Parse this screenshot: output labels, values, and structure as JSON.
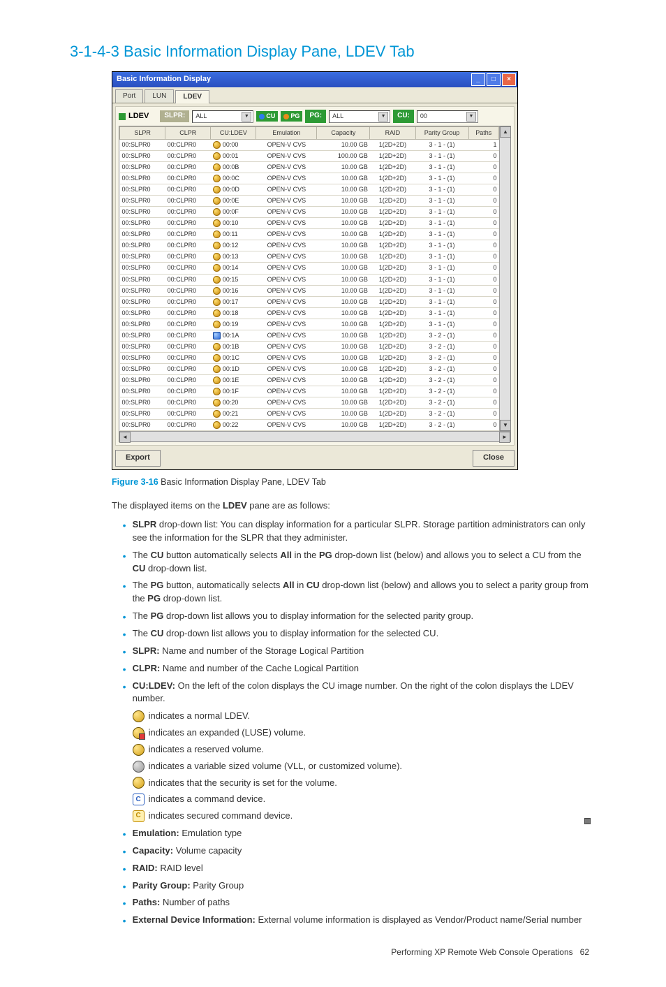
{
  "heading": "3-1-4-3 Basic Information Display Pane, LDEV Tab",
  "figure": {
    "num": "Figure 3-16",
    "caption": "Basic Information Display Pane, LDEV Tab"
  },
  "intro": "The displayed items on the LDEV pane are as follows:",
  "footer": {
    "text": "Performing XP Remote Web Console Operations",
    "page": "62"
  },
  "window": {
    "title": "Basic Information Display",
    "tabs": [
      "Port",
      "LUN",
      "LDEV"
    ],
    "activeTab": "LDEV",
    "toolbar": {
      "ldev_label": "LDEV",
      "slpr_label": "SLPR:",
      "slpr_value": "ALL",
      "cu_btn": "CU",
      "pg_btn": "PG",
      "pg_label": "PG:",
      "pg_value": "ALL",
      "cu_label": "CU:",
      "cu_value": "00"
    },
    "columns": [
      "SLPR",
      "CLPR",
      "CU:LDEV",
      "Emulation",
      "Capacity",
      "RAID",
      "Parity Group",
      "Paths"
    ],
    "rows": [
      {
        "slpr": "00:SLPR0",
        "clpr": "00:CLPR0",
        "icon": "disk",
        "culdev": "00:00",
        "emu": "OPEN-V CVS",
        "cap": "10.00 GB",
        "raid": "1(2D+2D)",
        "pg": "3 - 1 - (1)",
        "paths": "1"
      },
      {
        "slpr": "00:SLPR0",
        "clpr": "00:CLPR0",
        "icon": "disk",
        "culdev": "00:01",
        "emu": "OPEN-V CVS",
        "cap": "100.00 GB",
        "raid": "1(2D+2D)",
        "pg": "3 - 1 - (1)",
        "paths": "0"
      },
      {
        "slpr": "00:SLPR0",
        "clpr": "00:CLPR0",
        "icon": "disk",
        "culdev": "00:0B",
        "emu": "OPEN-V CVS",
        "cap": "10.00 GB",
        "raid": "1(2D+2D)",
        "pg": "3 - 1 - (1)",
        "paths": "0"
      },
      {
        "slpr": "00:SLPR0",
        "clpr": "00:CLPR0",
        "icon": "disk",
        "culdev": "00:0C",
        "emu": "OPEN-V CVS",
        "cap": "10.00 GB",
        "raid": "1(2D+2D)",
        "pg": "3 - 1 - (1)",
        "paths": "0"
      },
      {
        "slpr": "00:SLPR0",
        "clpr": "00:CLPR0",
        "icon": "disk",
        "culdev": "00:0D",
        "emu": "OPEN-V CVS",
        "cap": "10.00 GB",
        "raid": "1(2D+2D)",
        "pg": "3 - 1 - (1)",
        "paths": "0"
      },
      {
        "slpr": "00:SLPR0",
        "clpr": "00:CLPR0",
        "icon": "disk",
        "culdev": "00:0E",
        "emu": "OPEN-V CVS",
        "cap": "10.00 GB",
        "raid": "1(2D+2D)",
        "pg": "3 - 1 - (1)",
        "paths": "0"
      },
      {
        "slpr": "00:SLPR0",
        "clpr": "00:CLPR0",
        "icon": "disk",
        "culdev": "00:0F",
        "emu": "OPEN-V CVS",
        "cap": "10.00 GB",
        "raid": "1(2D+2D)",
        "pg": "3 - 1 - (1)",
        "paths": "0"
      },
      {
        "slpr": "00:SLPR0",
        "clpr": "00:CLPR0",
        "icon": "disk",
        "culdev": "00:10",
        "emu": "OPEN-V CVS",
        "cap": "10.00 GB",
        "raid": "1(2D+2D)",
        "pg": "3 - 1 - (1)",
        "paths": "0"
      },
      {
        "slpr": "00:SLPR0",
        "clpr": "00:CLPR0",
        "icon": "disk",
        "culdev": "00:11",
        "emu": "OPEN-V CVS",
        "cap": "10.00 GB",
        "raid": "1(2D+2D)",
        "pg": "3 - 1 - (1)",
        "paths": "0"
      },
      {
        "slpr": "00:SLPR0",
        "clpr": "00:CLPR0",
        "icon": "disk",
        "culdev": "00:12",
        "emu": "OPEN-V CVS",
        "cap": "10.00 GB",
        "raid": "1(2D+2D)",
        "pg": "3 - 1 - (1)",
        "paths": "0"
      },
      {
        "slpr": "00:SLPR0",
        "clpr": "00:CLPR0",
        "icon": "disk",
        "culdev": "00:13",
        "emu": "OPEN-V CVS",
        "cap": "10.00 GB",
        "raid": "1(2D+2D)",
        "pg": "3 - 1 - (1)",
        "paths": "0"
      },
      {
        "slpr": "00:SLPR0",
        "clpr": "00:CLPR0",
        "icon": "disk",
        "culdev": "00:14",
        "emu": "OPEN-V CVS",
        "cap": "10.00 GB",
        "raid": "1(2D+2D)",
        "pg": "3 - 1 - (1)",
        "paths": "0"
      },
      {
        "slpr": "00:SLPR0",
        "clpr": "00:CLPR0",
        "icon": "disk",
        "culdev": "00:15",
        "emu": "OPEN-V CVS",
        "cap": "10.00 GB",
        "raid": "1(2D+2D)",
        "pg": "3 - 1 - (1)",
        "paths": "0"
      },
      {
        "slpr": "00:SLPR0",
        "clpr": "00:CLPR0",
        "icon": "disk",
        "culdev": "00:16",
        "emu": "OPEN-V CVS",
        "cap": "10.00 GB",
        "raid": "1(2D+2D)",
        "pg": "3 - 1 - (1)",
        "paths": "0"
      },
      {
        "slpr": "00:SLPR0",
        "clpr": "00:CLPR0",
        "icon": "disk",
        "culdev": "00:17",
        "emu": "OPEN-V CVS",
        "cap": "10.00 GB",
        "raid": "1(2D+2D)",
        "pg": "3 - 1 - (1)",
        "paths": "0"
      },
      {
        "slpr": "00:SLPR0",
        "clpr": "00:CLPR0",
        "icon": "disk",
        "culdev": "00:18",
        "emu": "OPEN-V CVS",
        "cap": "10.00 GB",
        "raid": "1(2D+2D)",
        "pg": "3 - 1 - (1)",
        "paths": "0"
      },
      {
        "slpr": "00:SLPR0",
        "clpr": "00:CLPR0",
        "icon": "disk",
        "culdev": "00:19",
        "emu": "OPEN-V CVS",
        "cap": "10.00 GB",
        "raid": "1(2D+2D)",
        "pg": "3 - 1 - (1)",
        "paths": "0"
      },
      {
        "slpr": "00:SLPR0",
        "clpr": "00:CLPR0",
        "icon": "cmd",
        "culdev": "00:1A",
        "emu": "OPEN-V CVS",
        "cap": "10.00 GB",
        "raid": "1(2D+2D)",
        "pg": "3 - 2 - (1)",
        "paths": "0"
      },
      {
        "slpr": "00:SLPR0",
        "clpr": "00:CLPR0",
        "icon": "disk",
        "culdev": "00:1B",
        "emu": "OPEN-V CVS",
        "cap": "10.00 GB",
        "raid": "1(2D+2D)",
        "pg": "3 - 2 - (1)",
        "paths": "0"
      },
      {
        "slpr": "00:SLPR0",
        "clpr": "00:CLPR0",
        "icon": "disk",
        "culdev": "00:1C",
        "emu": "OPEN-V CVS",
        "cap": "10.00 GB",
        "raid": "1(2D+2D)",
        "pg": "3 - 2 - (1)",
        "paths": "0"
      },
      {
        "slpr": "00:SLPR0",
        "clpr": "00:CLPR0",
        "icon": "disk",
        "culdev": "00:1D",
        "emu": "OPEN-V CVS",
        "cap": "10.00 GB",
        "raid": "1(2D+2D)",
        "pg": "3 - 2 - (1)",
        "paths": "0"
      },
      {
        "slpr": "00:SLPR0",
        "clpr": "00:CLPR0",
        "icon": "disk",
        "culdev": "00:1E",
        "emu": "OPEN-V CVS",
        "cap": "10.00 GB",
        "raid": "1(2D+2D)",
        "pg": "3 - 2 - (1)",
        "paths": "0"
      },
      {
        "slpr": "00:SLPR0",
        "clpr": "00:CLPR0",
        "icon": "disk",
        "culdev": "00:1F",
        "emu": "OPEN-V CVS",
        "cap": "10.00 GB",
        "raid": "1(2D+2D)",
        "pg": "3 - 2 - (1)",
        "paths": "0"
      },
      {
        "slpr": "00:SLPR0",
        "clpr": "00:CLPR0",
        "icon": "disk",
        "culdev": "00:20",
        "emu": "OPEN-V CVS",
        "cap": "10.00 GB",
        "raid": "1(2D+2D)",
        "pg": "3 - 2 - (1)",
        "paths": "0"
      },
      {
        "slpr": "00:SLPR0",
        "clpr": "00:CLPR0",
        "icon": "disk",
        "culdev": "00:21",
        "emu": "OPEN-V CVS",
        "cap": "10.00 GB",
        "raid": "1(2D+2D)",
        "pg": "3 - 2 - (1)",
        "paths": "0"
      },
      {
        "slpr": "00:SLPR0",
        "clpr": "00:CLPR0",
        "icon": "disk",
        "culdev": "00:22",
        "emu": "OPEN-V CVS",
        "cap": "10.00 GB",
        "raid": "1(2D+2D)",
        "pg": "3 - 2 - (1)",
        "paths": "0"
      }
    ],
    "buttons": {
      "export": "Export",
      "close": "Close"
    }
  },
  "bullets": {
    "slpr_dd_pre": "SLPR",
    "slpr_dd_post": " drop-down list: You can display information for a particular SLPR. Storage partition administrators can only see the information for the SLPR that they administer.",
    "cu_btn": "The CU button automatically selects All in the PG drop-down list (below) and allows you to select a CU from the CU drop-down list.",
    "pg_btn": "The PG button, automatically selects All in CU drop-down list (below) and allows you to select a parity group from the PG drop-down list.",
    "pg_dd": "The PG drop-down list allows you to display information for the selected parity group.",
    "cu_dd": "The CU drop-down list allows you to display information for the selected CU.",
    "slpr_field_b": "SLPR:",
    "slpr_field_t": " Name and number of the Storage Logical Partition",
    "clpr_field_b": "CLPR:",
    "clpr_field_t": " Name and number of the Cache Logical Partition",
    "culdev_b": "CU:LDEV:",
    "culdev_t": "  On the left of the colon displays the CU image number. On the right of the colon displays the LDEV number.",
    "legend": [
      {
        "icon": "normal",
        "text": " indicates a normal LDEV."
      },
      {
        "icon": "luse",
        "text": " indicates an expanded (LUSE) volume."
      },
      {
        "icon": "reserved",
        "text": " indicates a reserved volume."
      },
      {
        "icon": "vll",
        "text": " indicates a variable sized volume (VLL, or customized volume)."
      },
      {
        "icon": "security",
        "text": " indicates that the security is set for the volume."
      },
      {
        "icon": "cmd",
        "text": " indicates a command device."
      },
      {
        "icon": "cmdsec",
        "text": " indicates secured command device."
      }
    ],
    "emu_b": "Emulation:",
    "emu_t": " Emulation type",
    "cap_b": "Capacity:",
    "cap_t": "  Volume capacity",
    "raid_b": "RAID:",
    "raid_t": "  RAID level",
    "pg_field_b": "Parity Group:",
    "pg_field_t": "  Parity Group",
    "paths_b": "Paths:",
    "paths_t": "  Number of paths",
    "ext_b": "External Device Information:",
    "ext_t": "  External volume information is displayed as Vendor/Product name/Serial number"
  }
}
